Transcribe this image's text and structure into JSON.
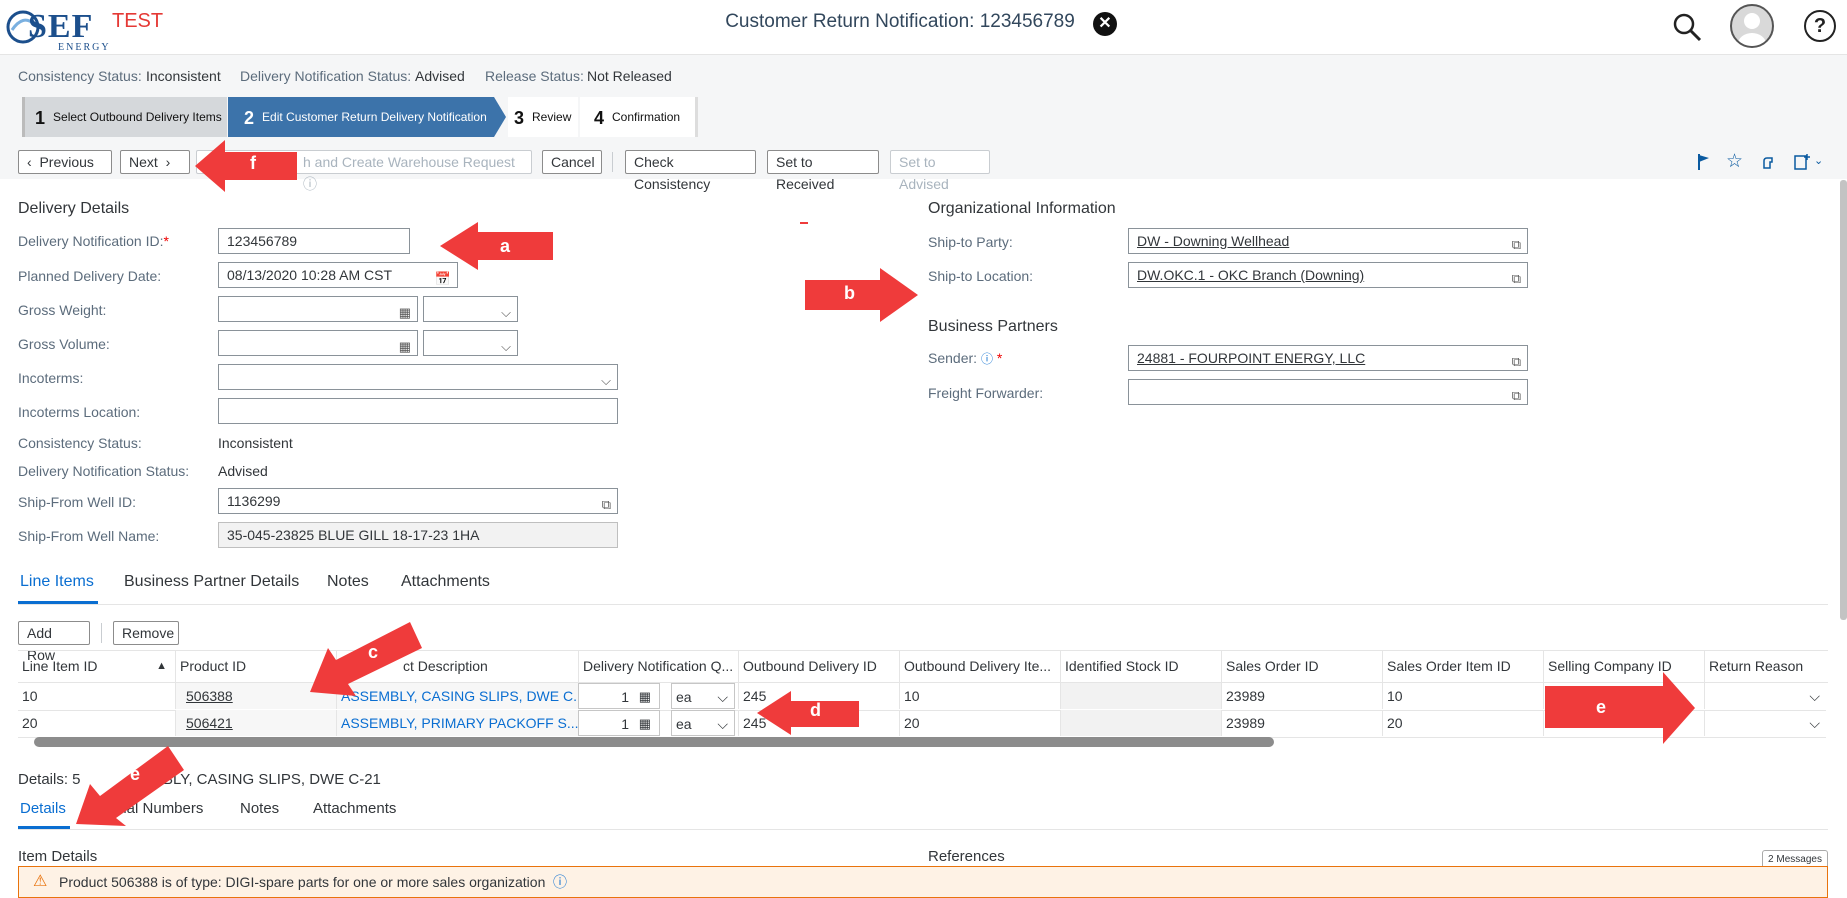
{
  "shell": {
    "logo_text": "SEF",
    "logo_sub": "ENERGY",
    "env": "TEST",
    "title": "Customer Return Notification: 123456789"
  },
  "header_status": {
    "consistency_label": "Consistency Status:",
    "consistency_value": "Inconsistent",
    "delivery_label": "Delivery Notification Status:",
    "delivery_value": "Advised",
    "release_label": "Release Status:",
    "release_value": "Not Released"
  },
  "wizard": {
    "steps": [
      {
        "num": "1",
        "label": "Select Outbound Delivery Items"
      },
      {
        "num": "2",
        "label": "Edit Customer Return Delivery Notification"
      },
      {
        "num": "3",
        "label": "Review"
      },
      {
        "num": "4",
        "label": "Confirmation"
      }
    ]
  },
  "toolbar": {
    "previous": "Previous",
    "next": "Next",
    "finish": "h and Create Warehouse Request",
    "cancel": "Cancel",
    "check": "Check Consistency",
    "received": "Set to Received",
    "advised": "Set to Advised"
  },
  "delivery": {
    "title": "Delivery Details",
    "id_label": "Delivery Notification ID:",
    "id_value": "123456789",
    "planned_label": "Planned Delivery Date:",
    "planned_value": "08/13/2020 10:28 AM CST",
    "gross_weight_label": "Gross Weight:",
    "gross_volume_label": "Gross Volume:",
    "incoterms_label": "Incoterms:",
    "incoterms_loc_label": "Incoterms Location:",
    "consistency_label": "Consistency Status:",
    "consistency_value": "Inconsistent",
    "dn_status_label": "Delivery Notification Status:",
    "dn_status_value": "Advised",
    "well_id_label": "Ship-From Well ID:",
    "well_id_value": "1136299",
    "well_name_label": "Ship-From Well Name:",
    "well_name_value": "35-045-23825 BLUE GILL 18-17-23 1HA"
  },
  "org": {
    "title": "Organizational Information",
    "party_label": "Ship-to Party:",
    "party_value": "DW - Downing Wellhead",
    "location_label": "Ship-to Location:",
    "location_value": "DW.OKC.1 - OKC Branch (Downing)",
    "bp_title": "Business Partners",
    "sender_label": "Sender:",
    "sender_value": "24881 - FOURPOINT ENERGY, LLC",
    "ff_label": "Freight Forwarder:"
  },
  "tabs": [
    "Line Items",
    "Business Partner Details",
    "Notes",
    "Attachments"
  ],
  "table_toolbar": {
    "add": "Add Row",
    "remove": "Remove"
  },
  "table": {
    "headers": [
      "Line Item ID",
      "Product ID",
      "ct Description",
      "Delivery Notification Q...",
      "Outbound Delivery ID",
      "Outbound Delivery Ite...",
      "Identified Stock ID",
      "Sales Order ID",
      "Sales Order Item ID",
      "Selling Company ID",
      "Return Reason"
    ],
    "rows": [
      {
        "line": "10",
        "product": "506388",
        "desc": "ASSEMBLY, CASING SLIPS, DWE C...",
        "qty": "1",
        "unit": "ea",
        "obd": "245",
        "obd_item": "10",
        "so": "23989",
        "so_item": "10"
      },
      {
        "line": "20",
        "product": "506421",
        "desc": "ASSEMBLY, PRIMARY PACKOFF S...",
        "qty": "1",
        "unit": "ea",
        "obd": "245",
        "obd_item": "20",
        "so": "23989",
        "so_item": "20"
      }
    ]
  },
  "details": {
    "heading": "Details: 5",
    "heading_rest": "EMBLY, CASING SLIPS, DWE C-21",
    "tabs": [
      "Details",
      "Serial Numbers",
      "Notes",
      "Attachments"
    ],
    "item_details": "Item Details",
    "references": "References",
    "messages": "2 Messages",
    "warning": "Product 506388 is of type: DIGI-spare parts for one or more sales organization"
  },
  "annotations": [
    "a",
    "b",
    "c",
    "d",
    "e",
    "e",
    "f"
  ],
  "colors": {
    "accent": "#0a6ed1",
    "wizard_active": "#3c73aa",
    "arrow": "#ef3b3b",
    "warning_bg": "#fef2e5"
  }
}
